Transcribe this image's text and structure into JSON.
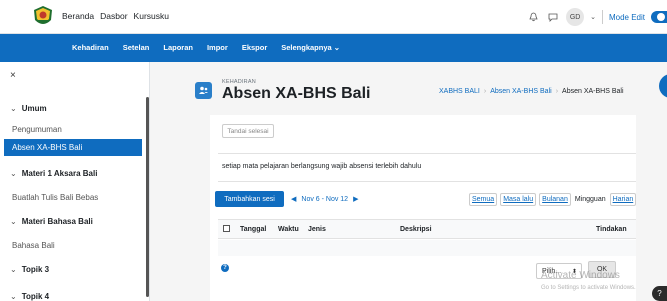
{
  "topnav": {
    "items": [
      "Beranda",
      "Dasbor",
      "Kursusku"
    ]
  },
  "header": {
    "user_initials": "GD",
    "mode_label": "Mode Edit"
  },
  "secnav": {
    "items": [
      "Kehadiran",
      "Setelan",
      "Laporan",
      "Impor",
      "Ekspor",
      "Selengkapnya ⌄"
    ]
  },
  "sidebar": {
    "close": "×",
    "sections": [
      {
        "label": "Umum",
        "items": [
          "Pengumuman",
          "Absen XA-BHS Bali"
        ]
      },
      {
        "label": "Materi 1 Aksara Bali",
        "items": [
          "Buatlah Tulis Bali Bebas"
        ]
      },
      {
        "label": "Materi Bahasa Bali",
        "items": [
          "Bahasa Bali"
        ]
      },
      {
        "label": "Topik 3",
        "items": []
      },
      {
        "label": "Topik 4",
        "items": []
      }
    ],
    "active_item": "Absen XA-BHS Bali"
  },
  "page": {
    "kicker": "KEHADIRAN",
    "title": "Absen XA-BHS Bali",
    "breadcrumb": [
      "XABHS BALI",
      "Absen XA-BHS Bali",
      "Absen XA-BHS Bali"
    ]
  },
  "content": {
    "mark_done": "Tandai selesai",
    "notice": "setiap mata pelajaran berlangsung wajib absensi terlebih dahulu",
    "add_session": "Tambahkan sesi",
    "week_range": "Nov 6 - Nov 12",
    "filters": [
      "Semua",
      "Masa lalu",
      "Bulanan",
      "Mingguan",
      "Harian"
    ],
    "active_filter": "Mingguan",
    "columns": [
      "Tanggal",
      "Waktu",
      "Jenis",
      "Deskripsi",
      "Tindakan"
    ],
    "select_value": "Pilih...",
    "ok_label": "OK"
  },
  "overlay": {
    "activate_title": "Activate Windows",
    "activate_sub": "Go to Settings to activate Windows."
  },
  "colors": {
    "primary": "#0f6cbf",
    "page_bg": "#f5f5f5"
  }
}
